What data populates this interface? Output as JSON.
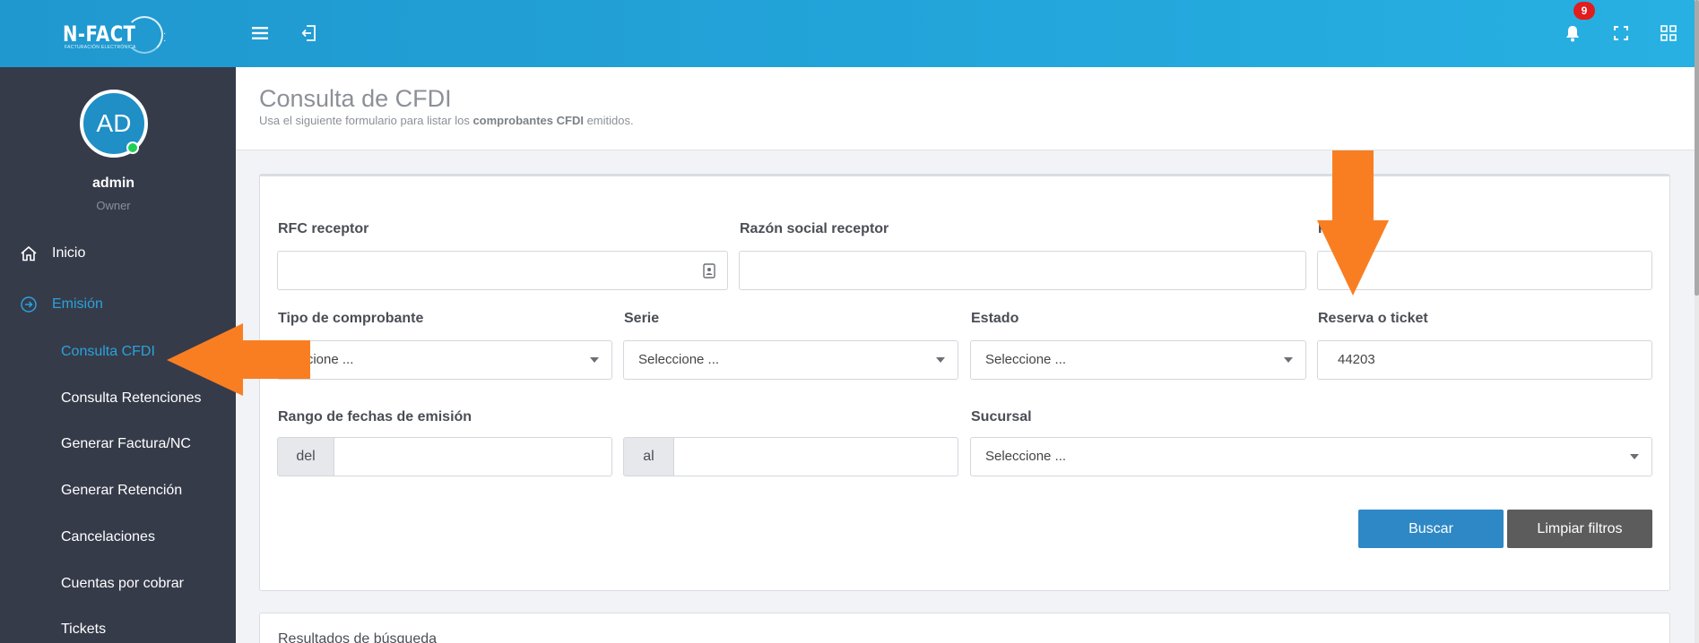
{
  "topbar": {
    "logo_text": "N-FACT",
    "logo_subtext": "FACTURACIÓN ELECTRÓNICA",
    "notification_count": "9",
    "colors": {
      "start": "#1f98cf",
      "end": "#28b0e2"
    }
  },
  "sidebar": {
    "avatar_initials": "AD",
    "user_name": "admin",
    "user_role": "Owner",
    "items": [
      {
        "label": "Inicio",
        "icon": "home-icon"
      },
      {
        "label": "Emisión",
        "icon": "arrow-circle-right-icon"
      }
    ],
    "subitems": [
      {
        "label": "Consulta CFDI"
      },
      {
        "label": "Consulta Retenciones"
      },
      {
        "label": "Generar Factura/NC"
      },
      {
        "label": "Generar Retención"
      },
      {
        "label": "Cancelaciones"
      },
      {
        "label": "Cuentas por cobrar"
      },
      {
        "label": "Tickets"
      }
    ]
  },
  "header": {
    "title": "Consulta de CFDI",
    "subtitle_before": "Usa el siguiente formulario para listar los ",
    "subtitle_bold": "comprobantes CFDI",
    "subtitle_after": " emitidos."
  },
  "form": {
    "rfc_label": "RFC receptor",
    "rfc_value": "",
    "razon_label": "Razón social receptor",
    "razon_value": "",
    "third_label": "F",
    "third_value": "",
    "tipo_label": "Tipo de comprobante",
    "tipo_value": "eccione ...",
    "serie_label": "Serie",
    "serie_value": "Seleccione ...",
    "estado_label": "Estado",
    "estado_value": "Seleccione ...",
    "reserva_label": "Reserva o ticket",
    "reserva_value": "44203",
    "rango_label": "Rango de fechas de emisión",
    "del_label": "del",
    "al_label": "al",
    "del_value": "",
    "al_value": "",
    "sucursal_label": "Sucursal",
    "sucursal_value": "Seleccione ...",
    "buscar_label": "Buscar",
    "limpiar_label": "Limpiar filtros"
  },
  "results": {
    "title": "Resultados de búsqueda"
  },
  "annotations": {
    "arrow_color": "#f97e22"
  }
}
